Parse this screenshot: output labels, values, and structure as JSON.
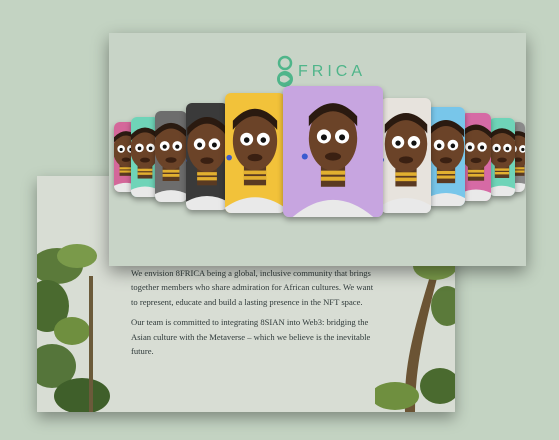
{
  "brand": {
    "logo_text": "FRICA",
    "accent_color": "#4fb58a"
  },
  "about": {
    "paragraph_1": "We envision 8FRICA being a global, inclusive community that brings together members who share admiration for African cultures. We want to represent, educate and build a lasting presence in the NFT space.",
    "paragraph_2": "Our team is committed to integrating 8SIAN into Web3: bridging the Asian culture with the Metaverse – which we believe is the inevitable future."
  },
  "carousel": {
    "cards": [
      {
        "name": "nft-card-1",
        "bg": "#d4679a"
      },
      {
        "name": "nft-card-2",
        "bg": "#6fd4b8"
      },
      {
        "name": "nft-card-3",
        "bg": "#6d6d6d"
      },
      {
        "name": "nft-card-4",
        "bg": "#3a3a3a"
      },
      {
        "name": "nft-card-5",
        "bg": "#f2c23a"
      },
      {
        "name": "nft-card-center",
        "bg": "#c7a5e0"
      },
      {
        "name": "nft-card-7",
        "bg": "#e7e3dd"
      },
      {
        "name": "nft-card-8",
        "bg": "#78c6ea"
      },
      {
        "name": "nft-card-9",
        "bg": "#d66aa5"
      },
      {
        "name": "nft-card-10",
        "bg": "#6fd4b8"
      },
      {
        "name": "nft-card-11",
        "bg": "#8a8a8a"
      }
    ]
  }
}
